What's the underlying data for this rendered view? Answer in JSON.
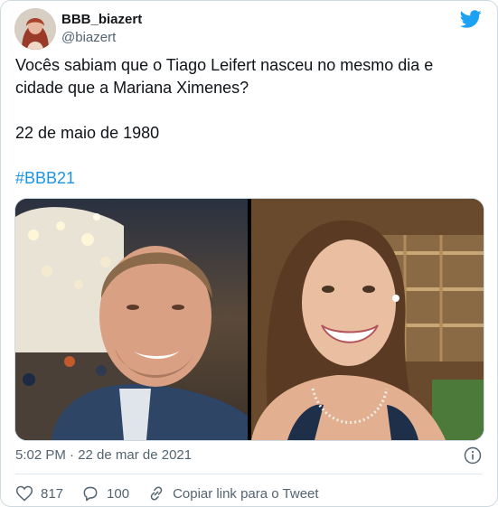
{
  "header": {
    "display_name": "BBB_biazert",
    "handle": "@biazert",
    "logo_icon": "twitter-bird-icon",
    "brand_color": "#1da1f2"
  },
  "tweet": {
    "line1": "Vocês sabiam que o Tiago Leifert nasceu no mesmo dia e cidade que a Mariana Ximenes?",
    "line2": "22 de maio de 1980",
    "hashtag": "#BBB21",
    "hashtag_color": "#1b95e0"
  },
  "media": {
    "images": [
      {
        "name": "photo-man-at-carnival",
        "icons": "photo"
      },
      {
        "name": "photo-woman-smiling",
        "icons": "photo"
      }
    ]
  },
  "meta": {
    "timestamp": "5:02 PM · 22 de mar de 2021",
    "info_icon": "info-icon"
  },
  "actions": {
    "likes_count": "817",
    "replies_count": "100",
    "copy_link_label": "Copiar link para o Tweet"
  }
}
